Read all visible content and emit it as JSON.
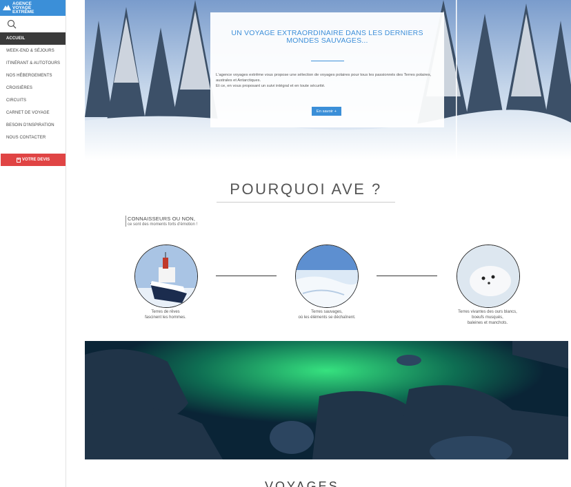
{
  "logo": {
    "line1": "AGENCE",
    "line2": "VOYAGE",
    "line3": "EXTRÊME"
  },
  "nav": [
    "ACCUEIL",
    "WEEK-END & SÉJOURS",
    "ITINÉRANT & AUTOTOURS",
    "NOS HÉBERGEMENTS",
    "CROISIÈRES",
    "CIRCUITS",
    "CARNET DE VOYAGE",
    "BESOIN D'INSPIRATION",
    "NOUS CONTACTER"
  ],
  "devis": "VOTRE DEVIS",
  "hero": {
    "title": "UN VOYAGE EXTRAORDINAIRE DANS LES DERNIERS MONDES SAUVAGES...",
    "text1": "L'agence voyages extrême vous propose une sélection de voyages polaires pour tous les passionnés des Terres polaires, australes et Antarctiques.",
    "text2": "Et ce, en vous proposant un suivi intégral et en toute sécurité.",
    "button": "En savoir +"
  },
  "section": {
    "title": "POURQUOI AVE ?",
    "subtitle": "CONNAISSEURS OU NON,",
    "subtext": "ce sont des moments forts d'émotion !"
  },
  "features": [
    {
      "caption1": "Terres de rêves",
      "caption2": "fascinent les hommes."
    },
    {
      "caption1": "Terres sauvages,",
      "caption2": "où les éléments se déchaînent."
    },
    {
      "caption1": "Terres vivantes des ours blancs,",
      "caption2": "boeufs musqués,",
      "caption3": "baleines et manchots."
    }
  ],
  "next_section": "VOYAGES",
  "colors": {
    "accent": "#3b8fd8",
    "devis": "#e04444",
    "nav_active": "#3a3a3a"
  }
}
